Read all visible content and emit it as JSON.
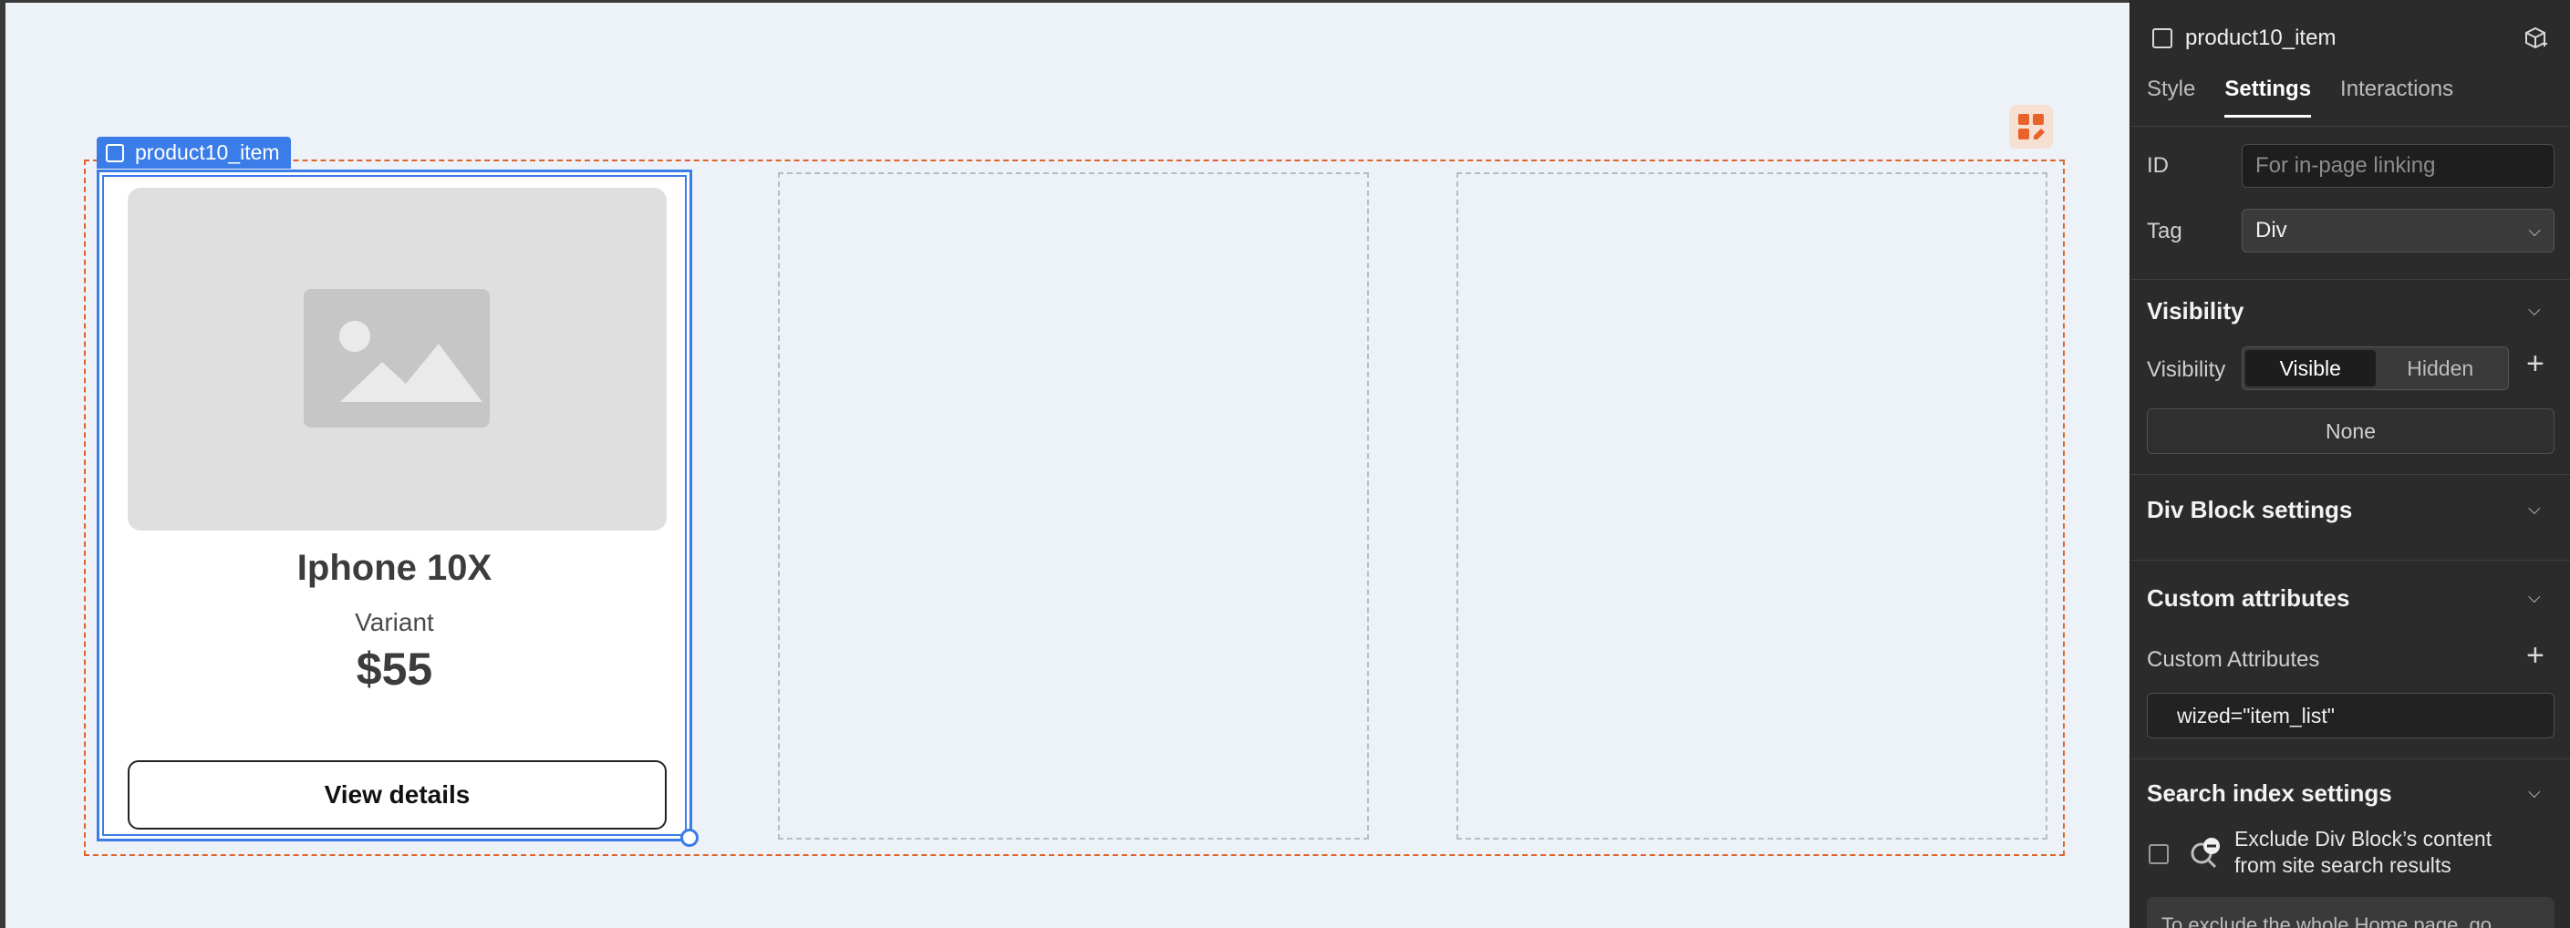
{
  "canvas": {
    "selection_tag": "product10_item",
    "card": {
      "title": "Iphone 10X",
      "variant": "Variant",
      "price": "$55",
      "button_label": "View details"
    },
    "icons": {
      "image_placeholder": "image-icon",
      "edit": "edit-grid-icon"
    },
    "colors": {
      "selection": "#3b7de8",
      "wrapper_outline": "#e0642a"
    }
  },
  "panel": {
    "element_name": "product10_item",
    "tabs": [
      {
        "label": "Style",
        "active": false
      },
      {
        "label": "Settings",
        "active": true
      },
      {
        "label": "Interactions",
        "active": false
      }
    ],
    "id_label": "ID",
    "id_placeholder": "For in-page linking",
    "tag_label": "Tag",
    "tag_value": "Div",
    "visibility_section": "Visibility",
    "visibility_label": "Visibility",
    "visibility_options": [
      "Visible",
      "Hidden"
    ],
    "visibility_selected": "Visible",
    "none_label": "None",
    "div_block_section": "Div Block settings",
    "custom_attr_section": "Custom attributes",
    "custom_attr_label": "Custom Attributes",
    "custom_attr_value": "wized=\"item_list\"",
    "search_section": "Search index settings",
    "exclude_text": "Exclude Div Block’s content from site search results",
    "hint_text": "To exclude the whole Home page, go"
  }
}
